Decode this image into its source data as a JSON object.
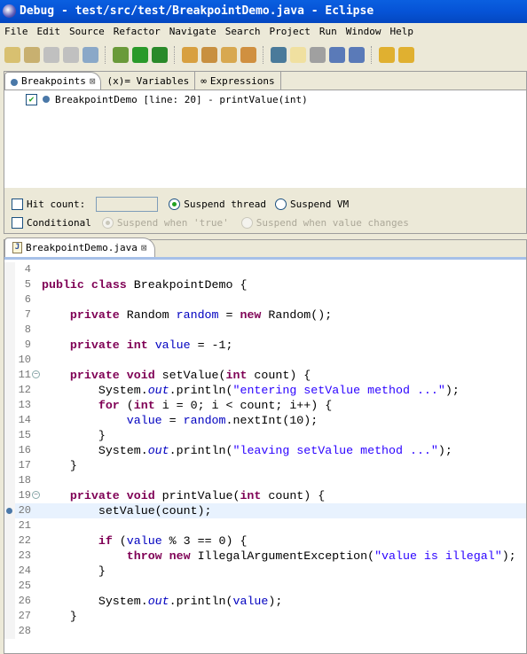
{
  "window": {
    "title": "Debug - test/src/test/BreakpointDemo.java - Eclipse"
  },
  "menu": [
    "File",
    "Edit",
    "Source",
    "Refactor",
    "Navigate",
    "Search",
    "Project",
    "Run",
    "Window",
    "Help"
  ],
  "toolbar": [
    "new-wizard",
    "new-class",
    "save",
    "save-all",
    "print",
    "debug",
    "run",
    "external-tools",
    "open-type",
    "open-task",
    "open-resource",
    "search",
    "toggle-breakpoint",
    "mark-occurrences",
    "skip-breakpoints",
    "show-block",
    "show-whitespace",
    "next-annotation",
    "prev-annotation"
  ],
  "breakpoints_view": {
    "tabs": [
      {
        "label": "Breakpoints",
        "active": true
      },
      {
        "label": "(x)= Variables"
      },
      {
        "label": "Expressions"
      }
    ],
    "items": [
      {
        "label": "BreakpointDemo [line: 20] - printValue(int)",
        "checked": true
      }
    ],
    "hit_count_label": "Hit count:",
    "hit_count_value": "",
    "suspend_thread": "Suspend thread",
    "suspend_vm": "Suspend VM",
    "conditional": "Conditional",
    "suspend_true": "Suspend when 'true'",
    "suspend_changes": "Suspend when value changes"
  },
  "editor": {
    "tab": "BreakpointDemo.java",
    "current_line": 20,
    "lines": [
      {
        "n": "4",
        "t": []
      },
      {
        "n": "5",
        "t": [
          [
            "kw",
            "public"
          ],
          [
            "",
            ""
          ],
          [
            "",
            " "
          ],
          [
            "kw",
            "class"
          ],
          [
            "",
            " BreakpointDemo {"
          ]
        ]
      },
      {
        "n": "6",
        "t": []
      },
      {
        "n": "7",
        "t": [
          [
            "",
            "    "
          ],
          [
            "kw",
            "private"
          ],
          [
            "",
            " Random "
          ],
          [
            "fld",
            "random"
          ],
          [
            "",
            " = "
          ],
          [
            "kw",
            "new"
          ],
          [
            "",
            " Random();"
          ]
        ]
      },
      {
        "n": "8",
        "t": []
      },
      {
        "n": "9",
        "t": [
          [
            "",
            "    "
          ],
          [
            "kw",
            "private int"
          ],
          [
            "",
            " "
          ],
          [
            "fld",
            "value"
          ],
          [
            "",
            " = -1;"
          ]
        ]
      },
      {
        "n": "10",
        "t": []
      },
      {
        "n": "11",
        "fold": true,
        "t": [
          [
            "",
            "    "
          ],
          [
            "kw",
            "private void"
          ],
          [
            "",
            " setValue("
          ],
          [
            "kw",
            "int"
          ],
          [
            "",
            " count) {"
          ]
        ]
      },
      {
        "n": "12",
        "t": [
          [
            "",
            "        System."
          ],
          [
            "st",
            "out"
          ],
          [
            "",
            ".println("
          ],
          [
            "str",
            "\"entering setValue method ...\""
          ],
          [
            "",
            ");"
          ]
        ]
      },
      {
        "n": "13",
        "t": [
          [
            "",
            "        "
          ],
          [
            "kw",
            "for"
          ],
          [
            "",
            " ("
          ],
          [
            "kw",
            "int"
          ],
          [
            "",
            " i = 0; i < count; i++) {"
          ]
        ]
      },
      {
        "n": "14",
        "t": [
          [
            "",
            "            "
          ],
          [
            "fld",
            "value"
          ],
          [
            "",
            " = "
          ],
          [
            "fld",
            "random"
          ],
          [
            "",
            ".nextInt(10);"
          ]
        ]
      },
      {
        "n": "15",
        "t": [
          [
            "",
            "        }"
          ]
        ]
      },
      {
        "n": "16",
        "t": [
          [
            "",
            "        System."
          ],
          [
            "st",
            "out"
          ],
          [
            "",
            ".println("
          ],
          [
            "str",
            "\"leaving setValue method ...\""
          ],
          [
            "",
            ");"
          ]
        ]
      },
      {
        "n": "17",
        "t": [
          [
            "",
            "    }"
          ]
        ]
      },
      {
        "n": "18",
        "t": []
      },
      {
        "n": "19",
        "fold": true,
        "t": [
          [
            "",
            "    "
          ],
          [
            "kw",
            "private void"
          ],
          [
            "",
            " printValue("
          ],
          [
            "kw",
            "int"
          ],
          [
            "",
            " count) {"
          ]
        ]
      },
      {
        "n": "20",
        "bp": true,
        "t": [
          [
            "",
            "        setValue(count);"
          ]
        ]
      },
      {
        "n": "21",
        "t": []
      },
      {
        "n": "22",
        "t": [
          [
            "",
            "        "
          ],
          [
            "kw",
            "if"
          ],
          [
            "",
            " ("
          ],
          [
            "fld",
            "value"
          ],
          [
            "",
            " % 3 == 0) {"
          ]
        ]
      },
      {
        "n": "23",
        "t": [
          [
            "",
            "            "
          ],
          [
            "kw",
            "throw new"
          ],
          [
            "",
            " IllegalArgumentException("
          ],
          [
            "str",
            "\"value is illegal\""
          ],
          [
            "",
            ");"
          ]
        ]
      },
      {
        "n": "24",
        "t": [
          [
            "",
            "        }"
          ]
        ]
      },
      {
        "n": "25",
        "t": []
      },
      {
        "n": "26",
        "t": [
          [
            "",
            "        System."
          ],
          [
            "st",
            "out"
          ],
          [
            "",
            ".println("
          ],
          [
            "fld",
            "value"
          ],
          [
            "",
            ");"
          ]
        ]
      },
      {
        "n": "27",
        "t": [
          [
            "",
            "    }"
          ]
        ]
      },
      {
        "n": "28",
        "t": []
      }
    ]
  }
}
